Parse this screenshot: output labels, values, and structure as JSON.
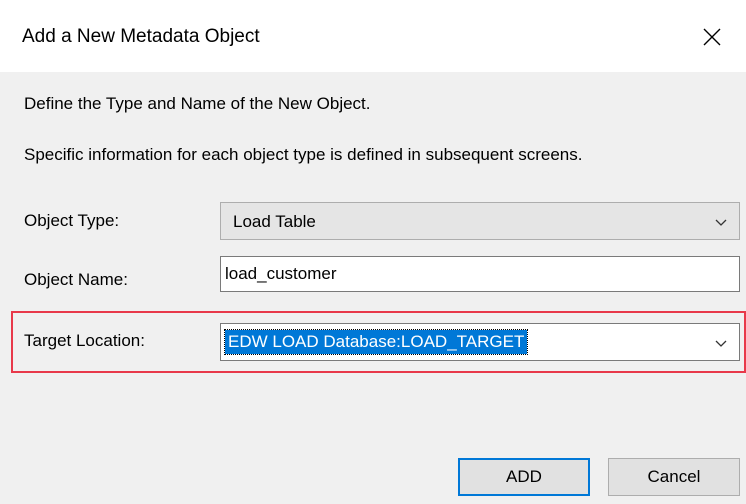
{
  "dialog": {
    "title": "Add a New Metadata Object",
    "close_icon": "close-icon"
  },
  "intro": {
    "line1": "Define the Type and Name of the New Object.",
    "line2": "Specific information for each object type is defined in subsequent screens."
  },
  "form": {
    "object_type_label": "Object Type:",
    "object_type_value": "Load Table",
    "object_name_label": "Object Name:",
    "object_name_value": "load_customer",
    "target_location_label": "Target Location:",
    "target_location_value": "EDW LOAD Database:LOAD_TARGET"
  },
  "buttons": {
    "add_label": "ADD",
    "cancel_label": "Cancel"
  },
  "colors": {
    "highlight_border": "#e8394a",
    "selection": "#0078d7"
  }
}
